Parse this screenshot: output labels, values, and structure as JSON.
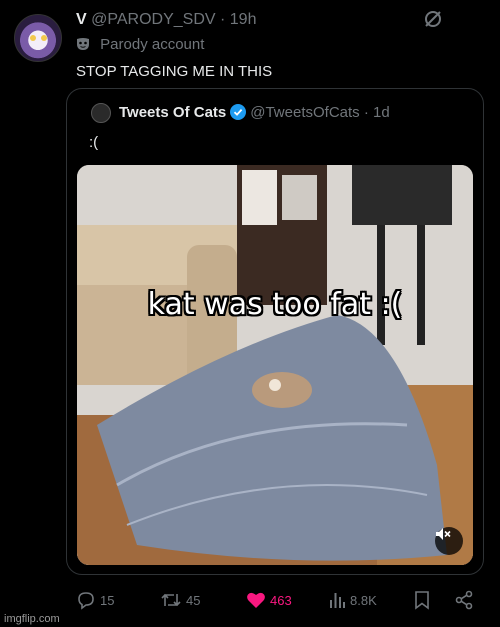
{
  "post": {
    "author_name": "V",
    "author_handle": "@PARODY_SDV",
    "time": "· 19h",
    "parody_label": "Parody account",
    "text": "STOP TAGGING ME IN THIS"
  },
  "quote": {
    "author_name": "Tweets Of Cats",
    "author_handle": "@TweetsOfCats",
    "time": "· 1d",
    "text": ":(",
    "media_caption": "kat was too fat :("
  },
  "actions": {
    "replies": "15",
    "reposts": "45",
    "likes": "463",
    "views": "8.8K"
  },
  "watermark": "imgflip.com",
  "colors": {
    "background": "#000000",
    "text": "#e7e9ea",
    "muted": "#71767b",
    "like": "#f91880",
    "verified": "#1d9bf0"
  }
}
